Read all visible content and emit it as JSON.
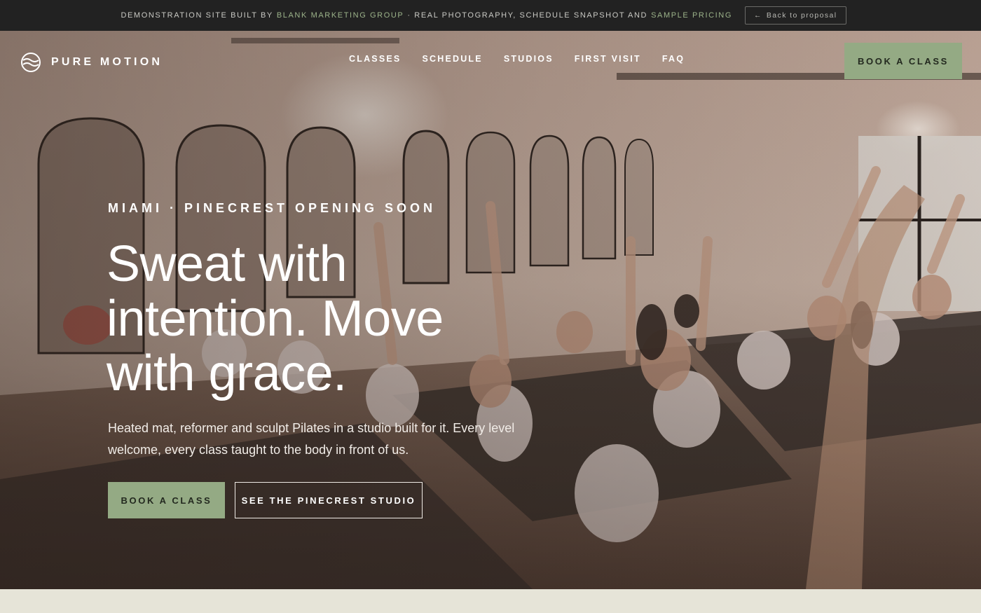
{
  "banner": {
    "prefix": "Demonstration site built by",
    "brand": "Blank Marketing Group",
    "middle": "· Real photography, schedule snapshot and",
    "pricing": "Sample pricing",
    "back_arrow": "←",
    "back_label": "Back to proposal"
  },
  "nav": {
    "logo_text": "PURE MOTION",
    "logo_icon": "wave-circle-icon",
    "menu": [
      "CLASSES",
      "SCHEDULE",
      "STUDIOS",
      "FIRST VISIT",
      "FAQ"
    ],
    "book_label": "BOOK A CLASS"
  },
  "hero": {
    "eyebrow": "MIAMI · PINECREST OPENING SOON",
    "headline": "Sweat with intention. Move with grace.",
    "lede": "Heated mat, reformer and sculpt Pilates in a studio built for it. Every level welcome, every class taught to the body in front of us.",
    "primary_cta": "BOOK A CLASS",
    "secondary_cta": "SEE THE PINECREST STUDIO"
  },
  "colors": {
    "accent": "#94aa84",
    "banner_bg": "#222222",
    "banner_highlight": "#9cb38a",
    "section_bg": "#e6e4d8"
  }
}
